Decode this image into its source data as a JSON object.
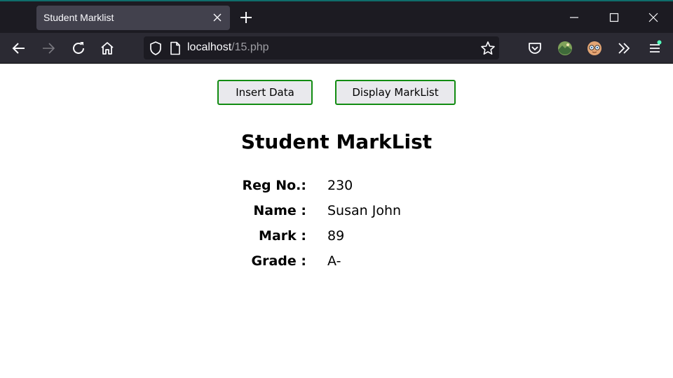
{
  "browser": {
    "tab_title": "Student Marklist",
    "url_host": "localhost",
    "url_path": "/15.php"
  },
  "actions": {
    "insert_label": "Insert Data",
    "display_label": "Display MarkList"
  },
  "marklist": {
    "title": "Student MarkList",
    "fields": [
      {
        "label": "Reg No.:",
        "value": "230"
      },
      {
        "label": "Name :",
        "value": "Susan John"
      },
      {
        "label": "Mark :",
        "value": "89"
      },
      {
        "label": "Grade :",
        "value": "A-"
      }
    ]
  },
  "colors": {
    "button_border": "#128c12",
    "button_bg": "#e9e9ed",
    "chrome_dark": "#1c1b22",
    "toolbar": "#2b2a33"
  }
}
